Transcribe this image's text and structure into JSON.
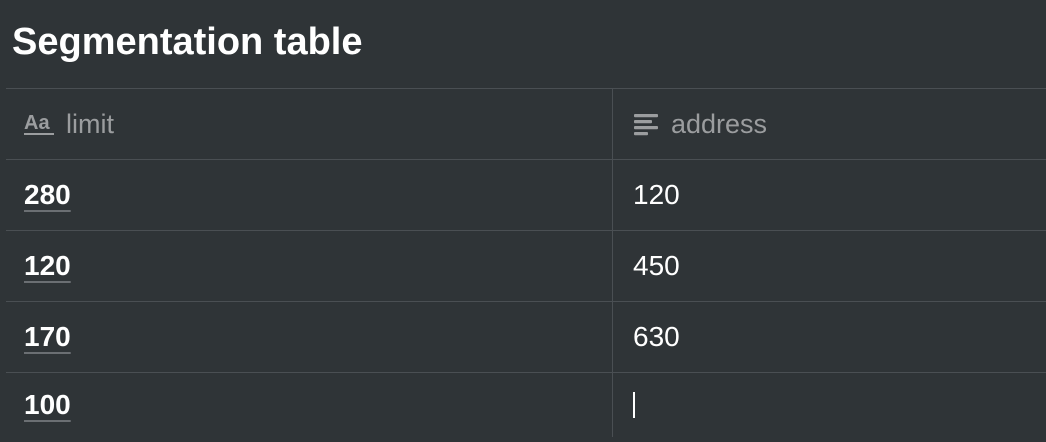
{
  "page": {
    "title": "Segmentation table"
  },
  "table": {
    "columns": [
      {
        "label": "limit",
        "icon": "title-property-icon"
      },
      {
        "label": "address",
        "icon": "text-property-icon"
      }
    ],
    "rows": [
      {
        "limit": "280",
        "address": "120"
      },
      {
        "limit": "120",
        "address": "450"
      },
      {
        "limit": "170",
        "address": "630"
      },
      {
        "limit": "100",
        "address": ""
      }
    ]
  }
}
